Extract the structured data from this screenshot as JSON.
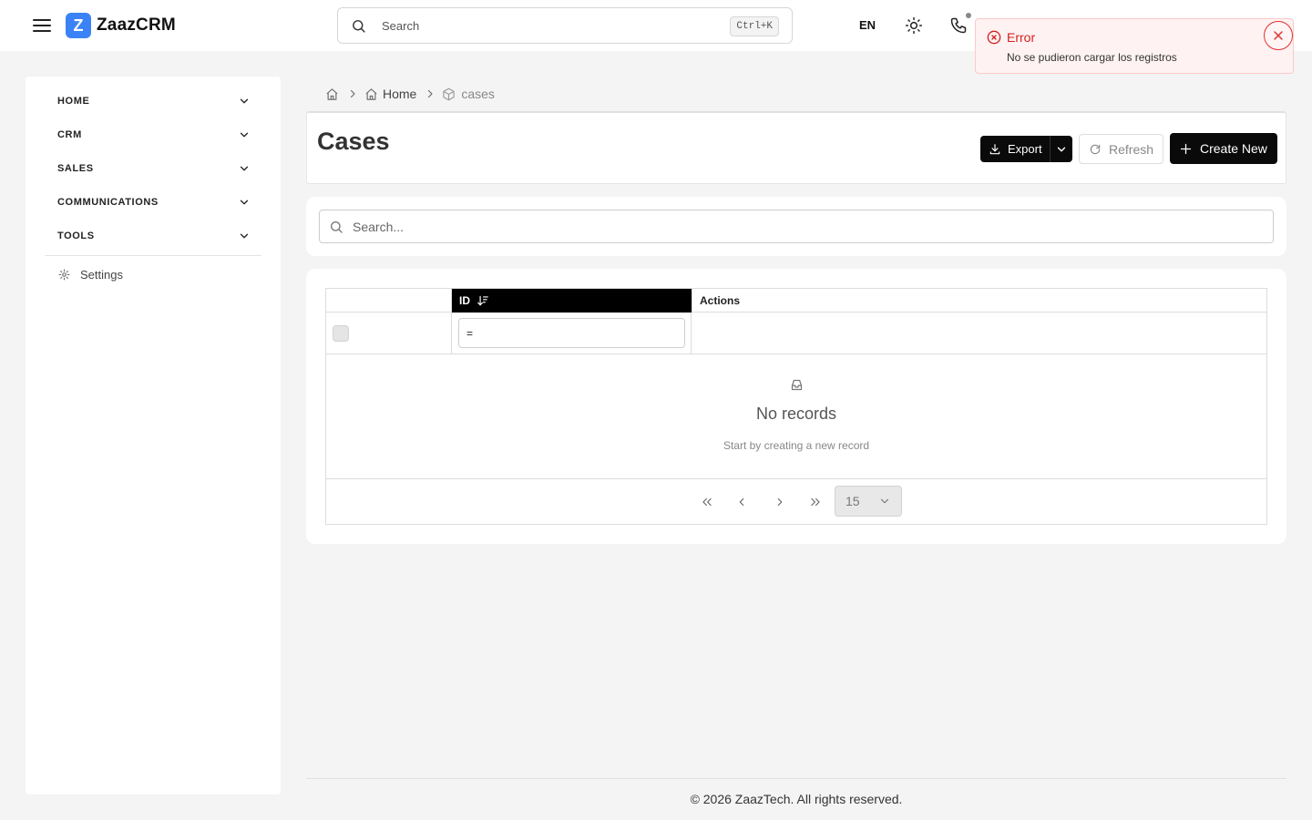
{
  "app": {
    "logo_letter": "Z",
    "name": "ZaazCRM",
    "brand_color": "#3b82f6"
  },
  "topbar": {
    "search_placeholder": "Search",
    "search_shortcut": "Ctrl+K",
    "language": "EN",
    "icons": [
      "menu-icon",
      "search-icon",
      "sun-icon",
      "phone-icon"
    ]
  },
  "toast": {
    "title": "Error",
    "message": "No se pudieron cargar los registros",
    "color": "#d61f1f"
  },
  "sidebar": {
    "items": [
      {
        "label": "HOME"
      },
      {
        "label": "CRM"
      },
      {
        "label": "SALES"
      },
      {
        "label": "COMMUNICATIONS"
      },
      {
        "label": "TOOLS"
      }
    ],
    "settings_label": "Settings"
  },
  "breadcrumb": {
    "home_label": "Home",
    "current": "cases"
  },
  "page": {
    "title": "Cases",
    "export_label": "Export",
    "refresh_label": "Refresh",
    "create_label": "Create New"
  },
  "table": {
    "search_placeholder": "Search...",
    "columns": [
      "ID",
      "Actions"
    ],
    "id_filter_value": "=",
    "empty_title": "No records",
    "empty_subtitle": "Start by creating a new record",
    "page_size": "15"
  },
  "footer": {
    "text": "© 2026 ZaazTech. All rights reserved."
  }
}
